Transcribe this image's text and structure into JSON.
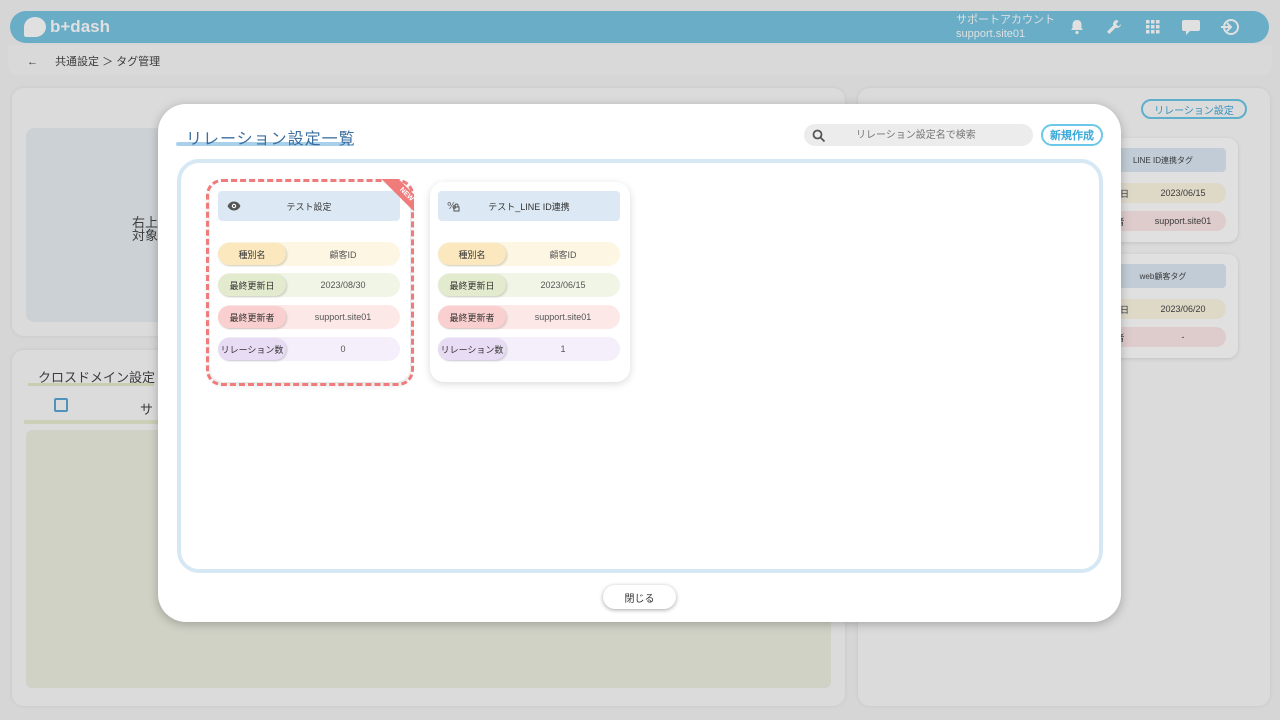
{
  "header": {
    "logo_text": "b+dash",
    "account_name": "サポートアカウント",
    "account_id": "support.site01",
    "icons": [
      "bell-icon",
      "wrench-icon",
      "grid-icon",
      "chat-icon",
      "logout-icon"
    ]
  },
  "breadcrumb": {
    "back": "←",
    "text": "共通設定 ＞ タグ管理"
  },
  "background": {
    "left_hint_1": "右上",
    "left_hint_2": "対象",
    "cross_domain_title": "クロスドメイン設定",
    "cross_domain_col": "サ",
    "relation_button": "リレーション設定",
    "right_cards": [
      {
        "name": "LINE ID連携タグ",
        "date": "2023/06/15",
        "user": "support.site01",
        "r1": "行日",
        "r2": "者"
      },
      {
        "name": "web顧客タグ",
        "date": "2023/06/20",
        "user": "-",
        "r1": "行日",
        "r2": "者"
      }
    ]
  },
  "modal": {
    "title": "リレーション設定一覧",
    "search_placeholder": "リレーション設定名で検索",
    "new_button": "新規作成",
    "close_button": "閉じる",
    "labels": {
      "type": "種別名",
      "updated": "最終更新日",
      "updater": "最終更新者",
      "count": "リレーション数"
    },
    "cards": [
      {
        "name": "テスト設定",
        "icon": "eye-icon",
        "badge": "NEW",
        "type": "顧客ID",
        "updated": "2023/08/30",
        "updater": "support.site01",
        "count": "0"
      },
      {
        "name": "テスト_LINE ID連携",
        "icon": "percent-lock-icon",
        "type": "顧客ID",
        "updated": "2023/06/15",
        "updater": "support.site01",
        "count": "1"
      }
    ]
  },
  "colors": {
    "header": "#78c5e3",
    "accent": "#3aa8d8",
    "dashed_highlight": "#ef7b7b"
  }
}
